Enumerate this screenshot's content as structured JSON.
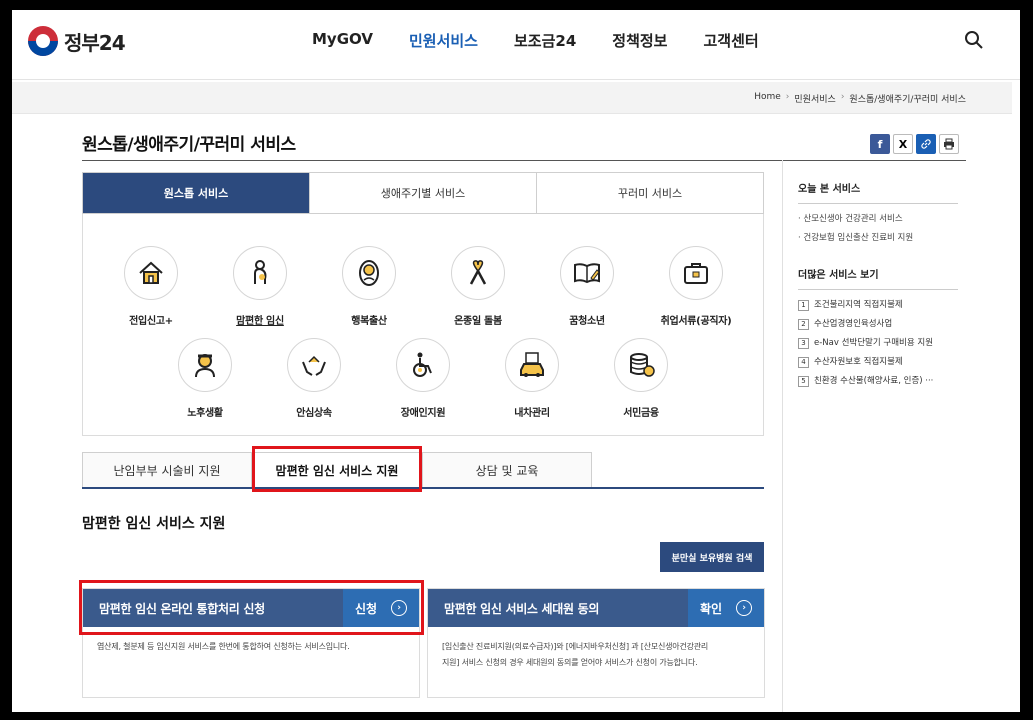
{
  "header": {
    "logo_text": "정부24",
    "nav": [
      "MyGOV",
      "민원서비스",
      "보조금24",
      "정책정보",
      "고객센터"
    ],
    "active_nav": "민원서비스"
  },
  "breadcrumb": [
    "Home",
    "민원서비스",
    "원스톱/생애주기/꾸러미 서비스"
  ],
  "page_title": "원스톱/생애주기/꾸러미 서비스",
  "top_tabs": [
    "원스톱 서비스",
    "생애주기별 서비스",
    "꾸러미 서비스"
  ],
  "services": [
    {
      "label": "전입신고+",
      "icon": "house-icon"
    },
    {
      "label": "맘편한 임신",
      "icon": "pregnant-woman-icon"
    },
    {
      "label": "행복출산",
      "icon": "baby-icon"
    },
    {
      "label": "온종일 돌봄",
      "icon": "ribbon-icon"
    },
    {
      "label": "꿈청소년",
      "icon": "book-icon"
    },
    {
      "label": "취업서류(공직자)",
      "icon": "briefcase-icon"
    },
    {
      "label": "노후생활",
      "icon": "elderly-icon"
    },
    {
      "label": "안심상속",
      "icon": "hands-home-icon"
    },
    {
      "label": "장애인지원",
      "icon": "wheelchair-icon"
    },
    {
      "label": "내차관리",
      "icon": "car-icon"
    },
    {
      "label": "서민금융",
      "icon": "coins-icon"
    }
  ],
  "sub_tabs": [
    "난임부부 시술비 지원",
    "맘편한 임신 서비스 지원",
    "상담 및 교육"
  ],
  "section_title": "맘편한 임신 서비스 지원",
  "hospital_search_button": "분만실 보유병원 검색",
  "cards": [
    {
      "title": "맘편한 임신 온라인 통합처리 신청",
      "action": "신청",
      "desc": "엽산제, 철분제 등 임신지원 서비스를 한번에 통합하여 신청하는 서비스입니다."
    },
    {
      "title": "맘편한 임신 서비스 세대원 동의",
      "action": "확인",
      "desc_line1": "[임신출산 진료비지원(의료수급자)]와 [에너지바우처신청] 과 [산모신생아건강관리",
      "desc_line2": "지원] 서비스 신청의 경우 세대원의 동의를 얻어야 서비스가 신청이 가능합니다."
    }
  ],
  "aside": {
    "today_title": "오늘 본 서비스",
    "today_links": [
      "· 산모신생아 건강관리 서비스",
      "· 건강보험 임신출산 진료비 지원"
    ],
    "more_title": "더많은 서비스 보기",
    "more_links": [
      {
        "num": "1",
        "label": "조건불리지역 직접지불제"
      },
      {
        "num": "2",
        "label": "수산업경영인육성사업"
      },
      {
        "num": "3",
        "label": "e-Nav 선박단말기 구매비용 지원"
      },
      {
        "num": "4",
        "label": "수산자원보호 직접지불제"
      },
      {
        "num": "5",
        "label": "친환경 수산물(해양사료, 인증) ···"
      }
    ]
  },
  "share_buttons": [
    "f",
    "X"
  ],
  "colors": {
    "primary_navy": "#2c4a7e",
    "accent_blue": "#2d6db3",
    "highlight_red": "#e0151b",
    "active_nav": "#1a5fb4"
  }
}
